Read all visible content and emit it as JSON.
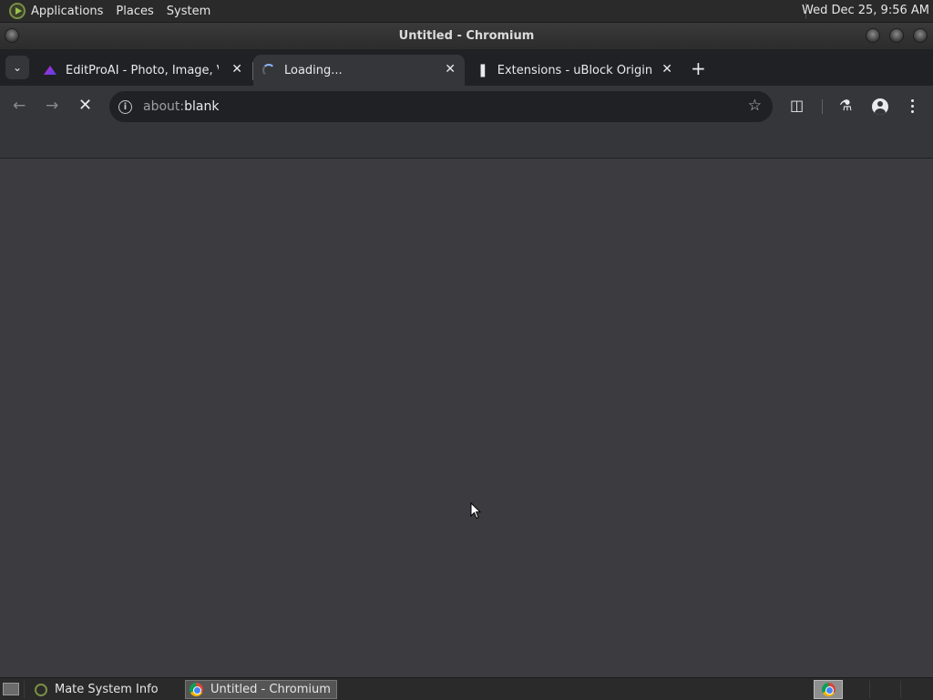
{
  "top_panel": {
    "menus": [
      "Applications",
      "Places",
      "System"
    ],
    "clock": "Wed Dec 25,  9:56 AM"
  },
  "window": {
    "title": "Untitled - Chromium"
  },
  "tabs": [
    {
      "label": "EditProAI - Photo, Image, Vid",
      "favicon": "editproai-icon"
    },
    {
      "label": "Loading...",
      "favicon": "loading-spinner-icon",
      "active": true
    },
    {
      "label": "Extensions - uBlock Origin",
      "favicon": "puzzle-icon"
    }
  ],
  "toolbar": {
    "url_scheme": "about:",
    "url_rest": "blank"
  },
  "taskbar": {
    "tasks": [
      {
        "label": "Mate System Info",
        "icon": "mate-icon"
      },
      {
        "label": "Untitled - Chromium",
        "icon": "chromium-icon",
        "active": true
      }
    ]
  },
  "colors": {
    "content_bg": "#3c3c40",
    "toolbar_bg": "#35363a",
    "tabstrip_bg": "#202124"
  }
}
